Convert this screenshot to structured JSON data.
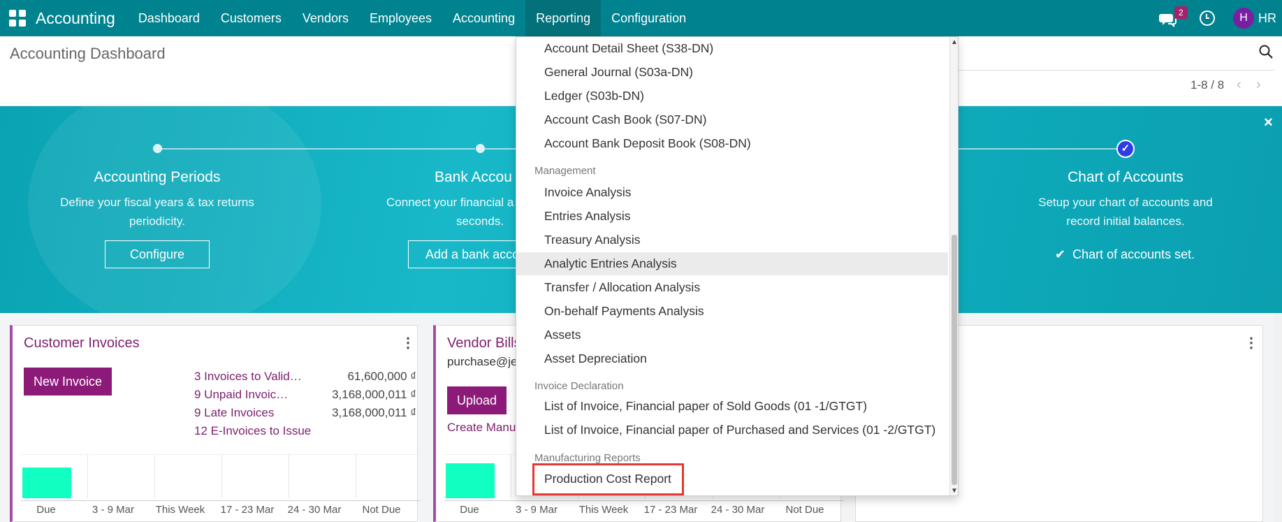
{
  "navbar": {
    "app_name": "Accounting",
    "menu": [
      "Dashboard",
      "Customers",
      "Vendors",
      "Employees",
      "Accounting",
      "Reporting",
      "Configuration"
    ],
    "active_menu": "Reporting",
    "chat_badge": "2",
    "avatar_letter": "H",
    "user_initials": "HR"
  },
  "control_panel": {
    "title": "Accounting Dashboard",
    "pager": "1-8 / 8",
    "prev": "‹",
    "next": "›"
  },
  "banner": {
    "close": "×",
    "steps": [
      {
        "title": "Accounting Periods",
        "desc_line1": "Define your fiscal years & tax returns",
        "desc_line2": "periodicity.",
        "button": "Configure"
      },
      {
        "title": "Bank Accou",
        "desc_line1": "Connect your financial a",
        "desc_line2": "seconds.",
        "button": "Add a bank acco"
      },
      {
        "title": "Chart of Accounts",
        "desc_line1": "Setup your chart of accounts and",
        "desc_line2": "record initial balances.",
        "done": "Chart of accounts set."
      }
    ]
  },
  "cards": {
    "customer": {
      "title": "Customer Invoices",
      "button": "New Invoice",
      "stats": [
        {
          "label": "3 Invoices to Valid…",
          "value": "61,600,000 ₫"
        },
        {
          "label": "9 Unpaid Invoic…",
          "value": "3,168,000,011 ₫"
        },
        {
          "label": "9 Late Invoices",
          "value": "3,168,000,011 ₫"
        },
        {
          "label": "12 E-Invoices to Issue",
          "value": ""
        }
      ],
      "axis": [
        "Due",
        "3 - 9 Mar",
        "This Week",
        "17 - 23 Mar",
        "24 - 30 Mar",
        "Not Due"
      ]
    },
    "vendor": {
      "title": "Vendor Bills",
      "email": "purchase@je",
      "button": "Upload",
      "link": "Create Manu",
      "axis": [
        "Due",
        "3 - 9 Mar",
        "This Week",
        "17 - 23 Mar",
        "24 - 30 Mar",
        "Not Due"
      ]
    }
  },
  "dropdown": {
    "items_top": [
      "Account Detail Sheet (S38-DN)",
      "General Journal (S03a-DN)",
      "Ledger (S03b-DN)",
      "Account Cash Book (S07-DN)",
      "Account Bank Deposit Book (S08-DN)"
    ],
    "management_header": "Management",
    "management_items": [
      "Invoice Analysis",
      "Entries Analysis",
      "Treasury Analysis",
      "Analytic Entries Analysis",
      "Transfer / Allocation Analysis",
      "On-behalf Payments Analysis",
      "Assets",
      "Asset Depreciation"
    ],
    "invoice_header": "Invoice Declaration",
    "invoice_items": [
      "List of Invoice, Financial paper of Sold Goods (01 -1/GTGT)",
      "List of Invoice, Financial paper of Purchased and Services (01 -2/GTGT)"
    ],
    "manufacturing_header": "Manufacturing Reports",
    "manufacturing_items": [
      "Production Cost Report"
    ]
  }
}
